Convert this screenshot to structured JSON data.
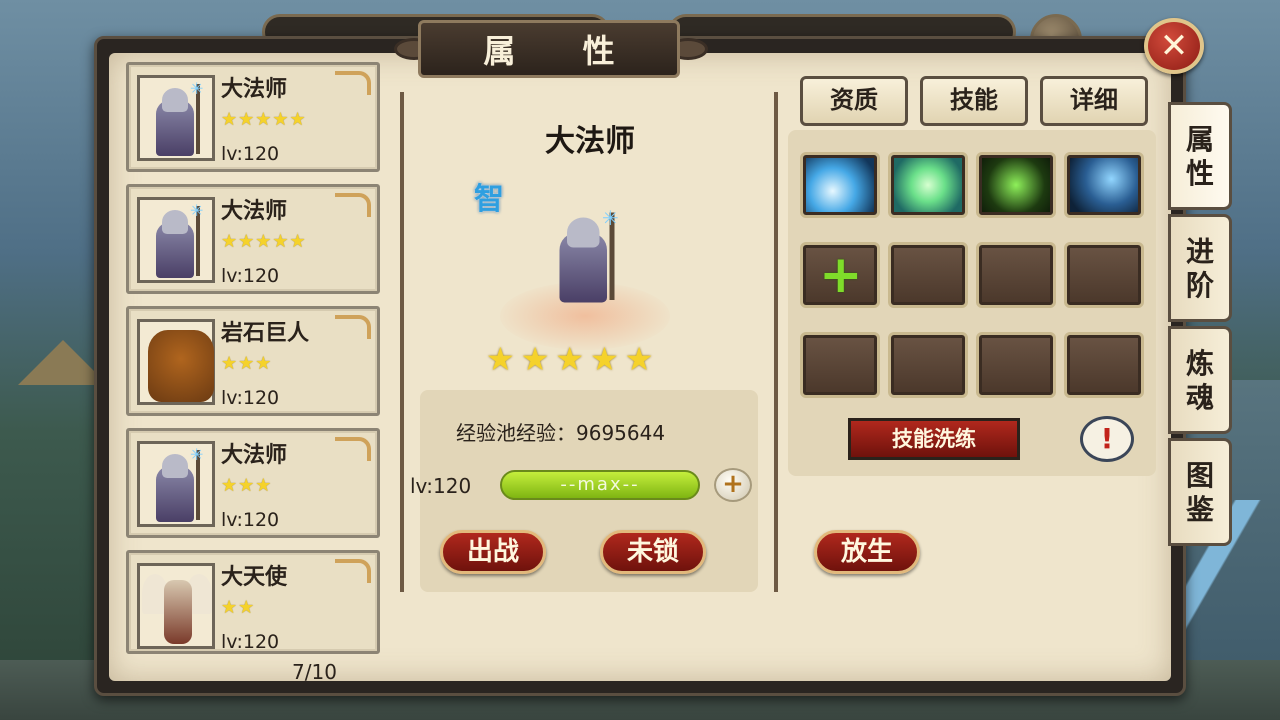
{
  "window_title": "属 性",
  "page_indicator": "7/10",
  "heroes": [
    {
      "name": "大法师",
      "stars": "★★★★★",
      "level": "lv:120",
      "portrait": "archmage-portrait"
    },
    {
      "name": "大法师",
      "stars": "★★★★★",
      "level": "lv:120",
      "portrait": "archmage-portrait"
    },
    {
      "name": "岩石巨人",
      "stars": "★★★",
      "level": "lv:120",
      "portrait": "rock-giant-portrait"
    },
    {
      "name": "大法师",
      "stars": "★★★",
      "level": "lv:120",
      "portrait": "archmage-portrait"
    },
    {
      "name": "大天使",
      "stars": "★★",
      "level": "lv:120",
      "portrait": "archangel-portrait"
    }
  ],
  "selected": {
    "name": "大法师",
    "class_glyph": "智",
    "stars": "★★★★★",
    "exp_text": "经验池经验：9695644",
    "level": "lv:120",
    "exp_bar_text": "--max--"
  },
  "buttons": {
    "deploy": "出战",
    "unlock": "未锁",
    "release": "放生",
    "refine": "技能洗练"
  },
  "tabs": {
    "aptitude": "资质",
    "skills": "技能",
    "details": "详细"
  },
  "side_tabs": [
    {
      "line1": "属",
      "line2": "性"
    },
    {
      "line1": "进",
      "line2": "阶"
    },
    {
      "line1": "炼",
      "line2": "魂"
    },
    {
      "line1": "图",
      "line2": "鉴"
    }
  ],
  "skill_slots": [
    "ice-shard-skill-icon",
    "healing-ring-skill-icon",
    "green-sparks-skill-icon",
    "lightning-skill-icon",
    "add-skill-icon",
    "empty",
    "empty",
    "empty",
    "empty",
    "empty",
    "empty",
    "empty"
  ],
  "colors": {
    "panel_bg": "#efe5cc",
    "button_red": "#b0281d",
    "star_gold": "#f5d22b",
    "exp_green": "#9bd322",
    "class_blue": "#2f9fe0"
  }
}
